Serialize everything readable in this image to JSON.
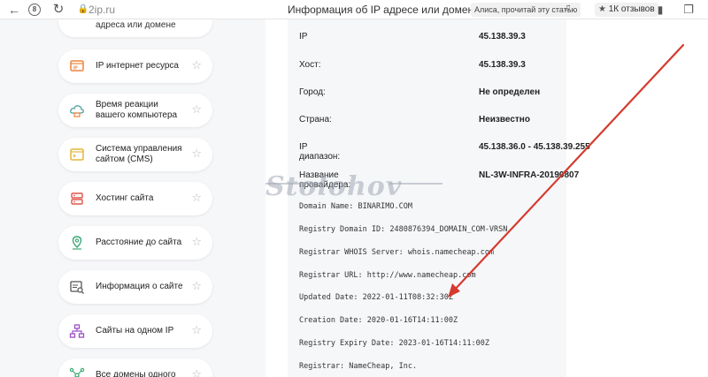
{
  "browser": {
    "back_icon": "back-arrow-icon",
    "badge_label": "8",
    "url": "2ip.ru",
    "title": "Информация об IP адресе или домене",
    "alisa_label": "Алиса, прочитай эту статью",
    "reviews_label": "1К отзывов"
  },
  "sidebar": {
    "cut_item_label": "адреса или домене",
    "items": [
      {
        "label": "IP интернет ресурса",
        "icon": "ip-resource-icon"
      },
      {
        "label": "Время реакции вашего компьютера",
        "icon": "cloud-speed-icon"
      },
      {
        "label": "Система управления сайтом (CMS)",
        "icon": "cms-window-icon"
      },
      {
        "label": "Хостинг сайта",
        "icon": "hosting-server-icon"
      },
      {
        "label": "Расстояние до сайта",
        "icon": "location-pin-icon"
      },
      {
        "label": "Информация о сайте",
        "icon": "site-info-icon"
      },
      {
        "label": "Сайты на одном IP",
        "icon": "network-tree-icon"
      },
      {
        "label": "Все домены одного",
        "icon": "domains-network-icon"
      }
    ]
  },
  "info": {
    "rows": [
      {
        "label": "IP",
        "value": "45.138.39.3"
      },
      {
        "label": "Хост:",
        "value": "45.138.39.3"
      },
      {
        "label": "Город:",
        "value": "Не определен"
      },
      {
        "label": "Страна:",
        "value": "Неизвестно"
      },
      {
        "label": "IP диапазон:",
        "value": "45.138.36.0 - 45.138.39.255"
      },
      {
        "label": "Название провайдера:",
        "value": "NL-3W-INFRA-20190807"
      }
    ],
    "whois": [
      "Domain Name: BINARIMO.COM",
      "Registry Domain ID: 2480876394_DOMAIN_COM-VRSN",
      "Registrar WHOIS Server: whois.namecheap.com",
      "Registrar URL: http://www.namecheap.com",
      "Updated Date: 2022-01-11T08:32:30Z",
      "Creation Date: 2020-01-16T14:11:00Z",
      "Registry Expiry Date: 2023-01-16T14:11:00Z",
      "Registrar: NameCheap, Inc."
    ]
  },
  "watermark": "Stolohov",
  "colors": {
    "accent_orange": "#f0843c",
    "arrow_red": "#d63a2f",
    "panel_bg": "#f6f7f9"
  }
}
